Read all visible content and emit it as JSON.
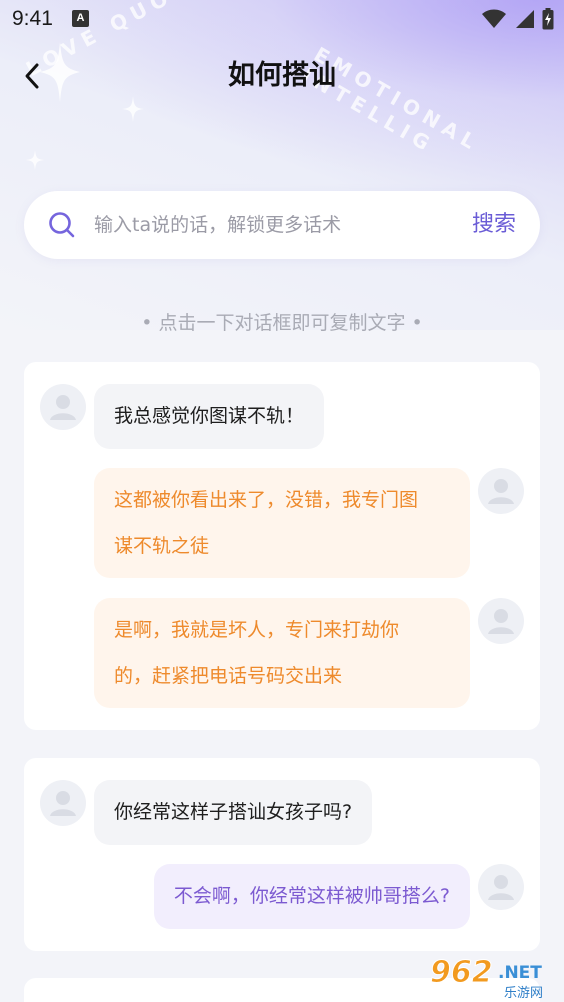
{
  "status": {
    "time": "9:41",
    "a_badge": "A"
  },
  "nav": {
    "title": "如何搭讪"
  },
  "decoration": {
    "left_text": "LOVE QUO",
    "right_text": "EMOTIONAL INTELLIG"
  },
  "search": {
    "placeholder": "输入ta说的话，解锁更多话术",
    "value": "",
    "button_label": "搜索"
  },
  "hint": "• 点击一下对话框即可复制文字 •",
  "cards": [
    {
      "messages": [
        {
          "side": "left",
          "text": "我总感觉你图谋不轨！"
        },
        {
          "side": "right",
          "style": "orange",
          "lines": [
            "这都被你看出来了，没错，我专门图",
            "谋不轨之徒"
          ]
        },
        {
          "side": "right",
          "style": "orange",
          "lines": [
            "是啊，我就是坏人，专门来打劫你",
            "的，赶紧把电话号码交出来"
          ]
        }
      ]
    },
    {
      "messages": [
        {
          "side": "left",
          "text": "你经常这样子搭讪女孩子吗?"
        },
        {
          "side": "right",
          "style": "purple",
          "text": "不会啊，你经常这样被帅哥搭么?"
        }
      ]
    }
  ],
  "watermark": {
    "main": "962",
    "suffix": ".NET",
    "sub": "乐游网"
  },
  "colors": {
    "accent": "#6a5cd6",
    "orange_text": "#ee8a2c",
    "purple_text": "#7c5ad1"
  }
}
